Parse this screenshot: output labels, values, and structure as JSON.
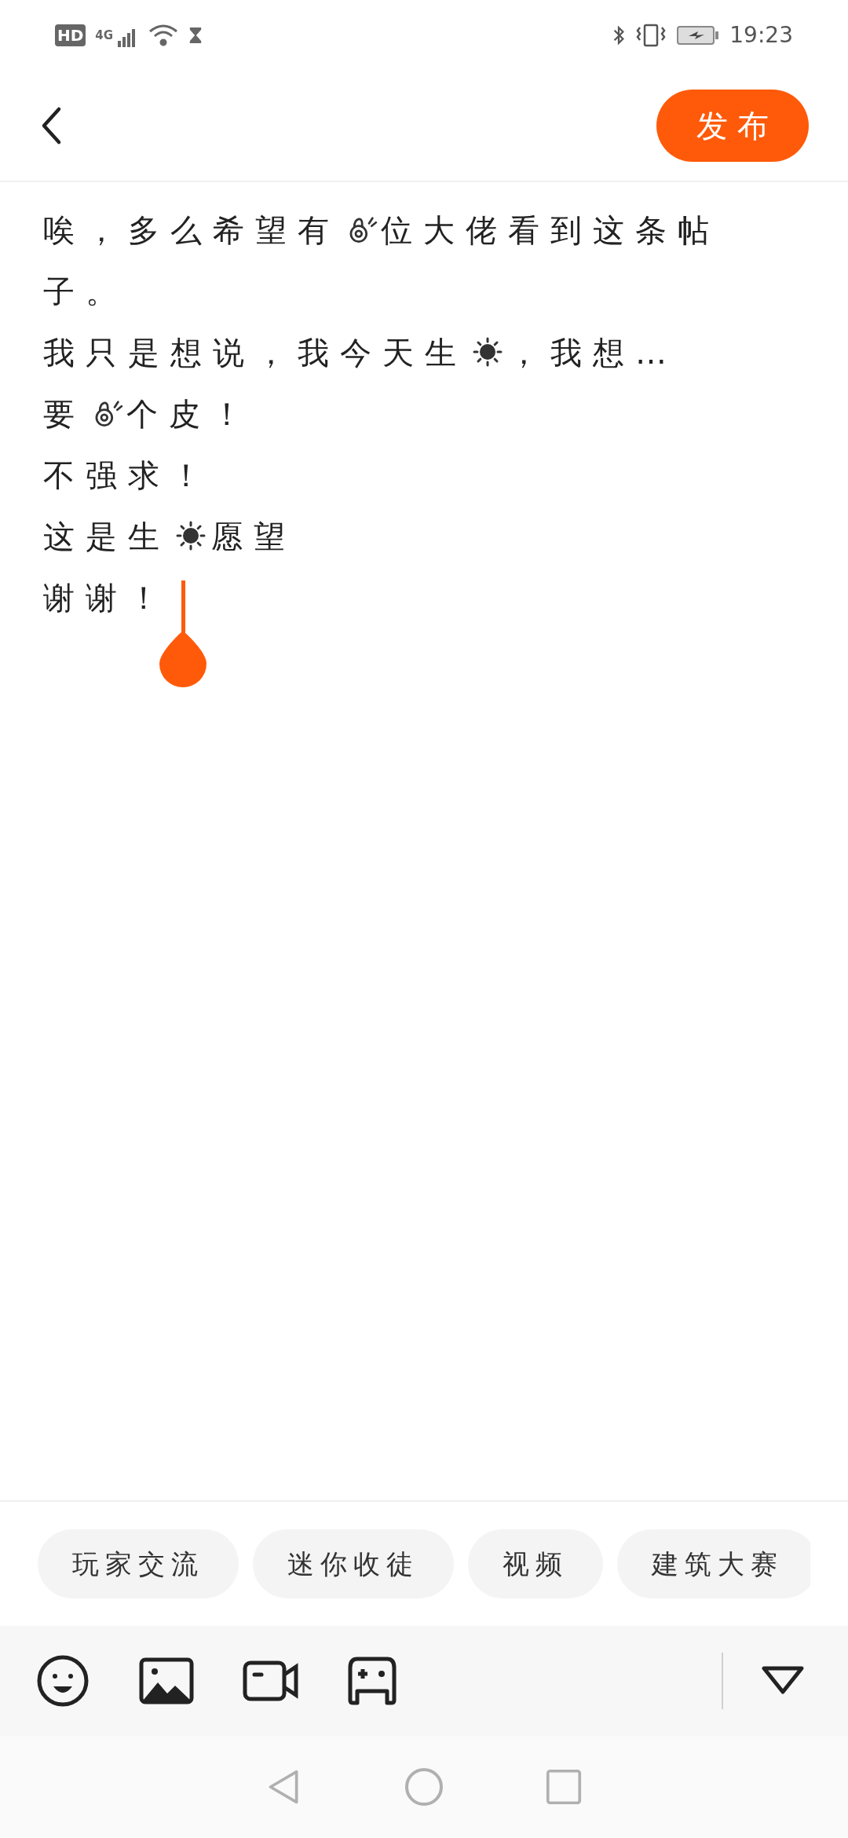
{
  "status_bar": {
    "hd": "HD",
    "network": "4G",
    "time": "19:23"
  },
  "header": {
    "publish_button": "发布"
  },
  "body": {
    "lines": [
      [
        {
          "kind": "text",
          "text": "唉，多么希望有"
        },
        {
          "kind": "hand"
        },
        {
          "kind": "text",
          "text": "位大佬看到这条帖"
        }
      ],
      [
        {
          "kind": "text",
          "text": "子。"
        }
      ],
      [
        {
          "kind": "text",
          "text": "我只是想说，我今天生"
        },
        {
          "kind": "sun"
        },
        {
          "kind": "text",
          "text": "，我想…"
        }
      ],
      [
        {
          "kind": "text",
          "text": "要"
        },
        {
          "kind": "hand"
        },
        {
          "kind": "text",
          "text": "个皮！"
        }
      ],
      [
        {
          "kind": "text",
          "text": "不强求！"
        }
      ],
      [
        {
          "kind": "text",
          "text": "这是生"
        },
        {
          "kind": "sun"
        },
        {
          "kind": "text",
          "text": "愿望"
        }
      ],
      [
        {
          "kind": "text",
          "text": "谢谢！"
        },
        {
          "kind": "cursor"
        }
      ]
    ]
  },
  "topics": [
    {
      "label": "玩家交流"
    },
    {
      "label": "迷你收徒"
    },
    {
      "label": "视频"
    },
    {
      "label": "建筑大赛"
    }
  ]
}
